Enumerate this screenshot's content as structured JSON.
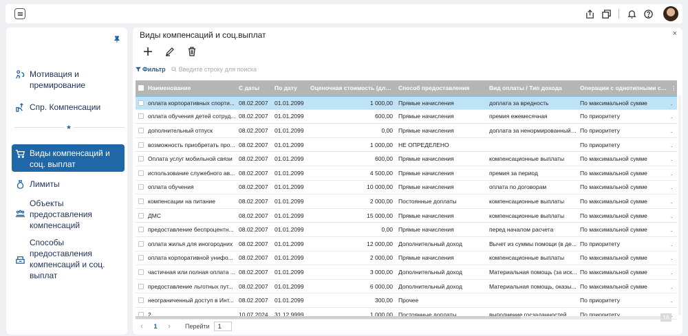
{
  "sidebar": {
    "items": [
      {
        "name": "Мотивация и премирование",
        "lines": [
          "Мотивация и",
          "премирование"
        ]
      },
      {
        "name": "Спр. Компенсации",
        "lines": [
          "Спр. Компенсации"
        ]
      },
      {
        "name": "Виды компенсаций и соц. выплат",
        "lines": [
          "Виды компенсаций и",
          "соц. выплат"
        ]
      },
      {
        "name": "Лимиты",
        "lines": [
          "Лимиты"
        ]
      },
      {
        "name": "Объекты предоставления компенсаций",
        "lines": [
          "Объекты",
          "предоставления",
          "компенсаций"
        ]
      },
      {
        "name": "Способы предоставления компенсаций и соц. выплат",
        "lines": [
          "Способы",
          "предоставления",
          "компенсаций и соц.",
          "выплат"
        ]
      }
    ]
  },
  "panel": {
    "title": "Виды компенсаций и соц.выплат",
    "close": "×",
    "filter_label": "Фильтр",
    "search_placeholder": "Введите строку для поиска"
  },
  "grid": {
    "columns": [
      "Наименование",
      "С даты",
      "По дату",
      "Оценочная стоимость (для м...",
      "Способ предоставления",
      "Вид оплаты / Тип дохода",
      "Операции с однотипными со..."
    ],
    "rows": [
      [
        "оплата корпоративных спорти...",
        "08.02.2007",
        "01.01.2099",
        "1 000,00",
        "Прямые начисления",
        "доплата за вредность",
        "По максимальной сумме"
      ],
      [
        "оплата обучения детей сотруд...",
        "08.02.2007",
        "01.01.2099",
        "600,00",
        "Прямые начисления",
        "премия ежемесячная",
        "По приоритету"
      ],
      [
        "дополнительный отпуск",
        "08.02.2007",
        "01.01.2099",
        "0,00",
        "Прямые начисления",
        "доплата за ненормированный ...",
        "По приоритету"
      ],
      [
        "возможность приобретать про...",
        "08.02.2007",
        "01.01.2099",
        "1 000,00",
        "НЕ ОПРЕДЕЛЕНО",
        "",
        "По приоритету"
      ],
      [
        "Оплата услуг мобильной связи",
        "08.02.2007",
        "01.01.2099",
        "600,00",
        "Прямые начисления",
        "компенсационные выплаты",
        "По максимальной сумме"
      ],
      [
        "использование служебного ав...",
        "08.02.2007",
        "01.01.2099",
        "4 500,00",
        "Прямые начисления",
        "премия за период",
        "По максимальной сумме"
      ],
      [
        "оплата обучения",
        "08.02.2007",
        "01.01.2099",
        "10 000,00",
        "Прямые начисления",
        "оплата по договорам",
        "По максимальной сумме"
      ],
      [
        "компенсации на питание",
        "08.02.2007",
        "01.01.2099",
        "2 000,00",
        "Постоянные доплаты",
        "компенсационные выплаты",
        "По максимальной сумме"
      ],
      [
        "ДМС",
        "08.02.2007",
        "01.01.2099",
        "15 000,00",
        "Прямые начисления",
        "компенсационные выплаты",
        "По максимальной сумме"
      ],
      [
        "предоставление беспроцентн...",
        "08.02.2007",
        "01.01.2099",
        "0,00",
        "Прямые начисления",
        "перед началом расчета",
        "По максимальной сумме"
      ],
      [
        "оплата жилья для иногородних",
        "08.02.2007",
        "01.01.2099",
        "12 000,00",
        "Дополнительный доход",
        "Вычет из суммы помощи (в де...",
        "По приоритету"
      ],
      [
        "оплата корпоративной унифо...",
        "08.02.2007",
        "01.01.2099",
        "2 000,00",
        "Прямые начисления",
        "компенсационные выплаты",
        "По максимальной сумме"
      ],
      [
        "частичная или полная оплата ...",
        "08.02.2007",
        "01.01.2099",
        "3 000,00",
        "Дополнительный доход",
        "Материальная помощь (за иск...",
        "По максимальной сумме"
      ],
      [
        "предоставление льготных пут...",
        "08.02.2007",
        "01.01.2099",
        "6 000,00",
        "Дополнительный доход",
        "Материальная помощь, оказы...",
        "По максимальной сумме"
      ],
      [
        "неограниченный доступ в Инт...",
        "08.02.2007",
        "01.01.2099",
        "300,00",
        "Прочее",
        "",
        "По приоритету"
      ],
      [
        "2",
        "10.07.2024",
        "31.12.9999",
        "1 000,00",
        "Постоянные доплаты",
        "выполнение госзаданностей",
        "По приоритету"
      ]
    ]
  },
  "pager": {
    "prev": "‹",
    "page": "1",
    "next": "›",
    "goto_label": "Перейти",
    "goto_value": "1",
    "count": "18"
  }
}
